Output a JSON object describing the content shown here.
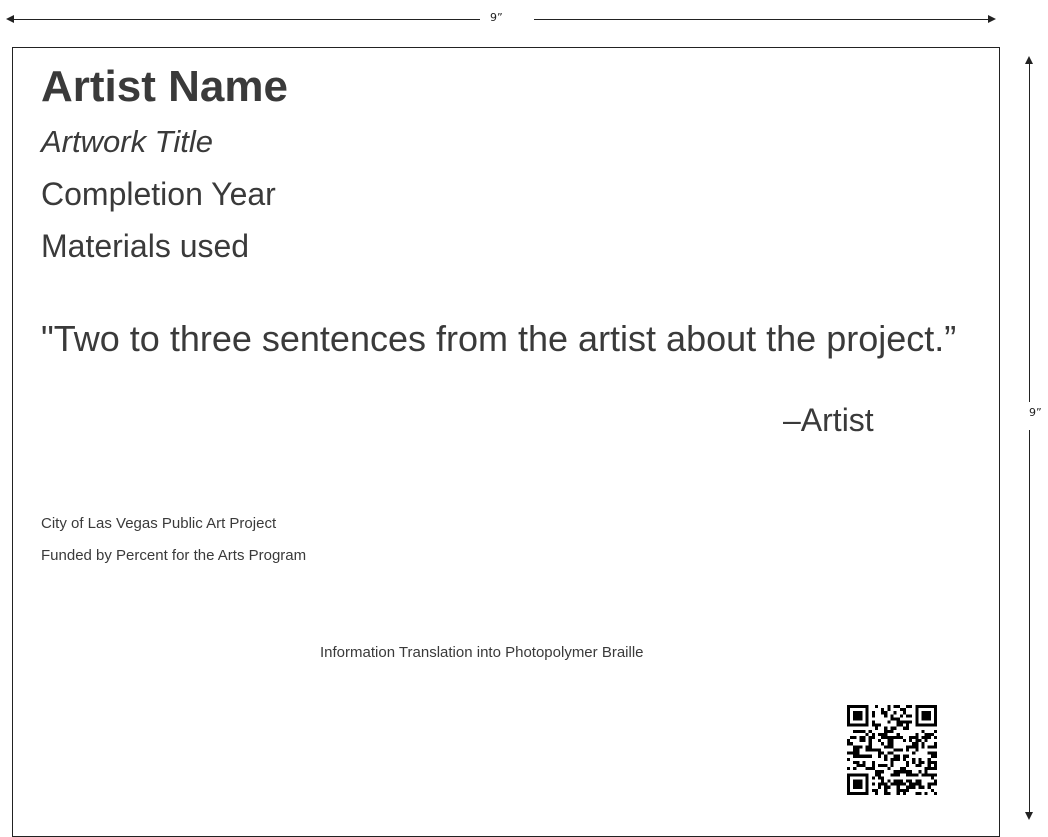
{
  "dimensions": {
    "width_label": "9”",
    "height_label": "9”"
  },
  "plaque": {
    "artist_name": "Artist Name",
    "artwork_title": "Artwork Title",
    "completion_year": "Completion Year",
    "materials": "Materials used",
    "quote": "\"Two to three sentences from the artist about the project.”",
    "attribution": "–Artist",
    "credit_line_1": "City of Las Vegas Public Art Project",
    "credit_line_2": "Funded by Percent for the Arts Program",
    "braille_note": "Information Translation into Photopolymer Braille",
    "qr_code_icon": "qr-code-icon"
  }
}
